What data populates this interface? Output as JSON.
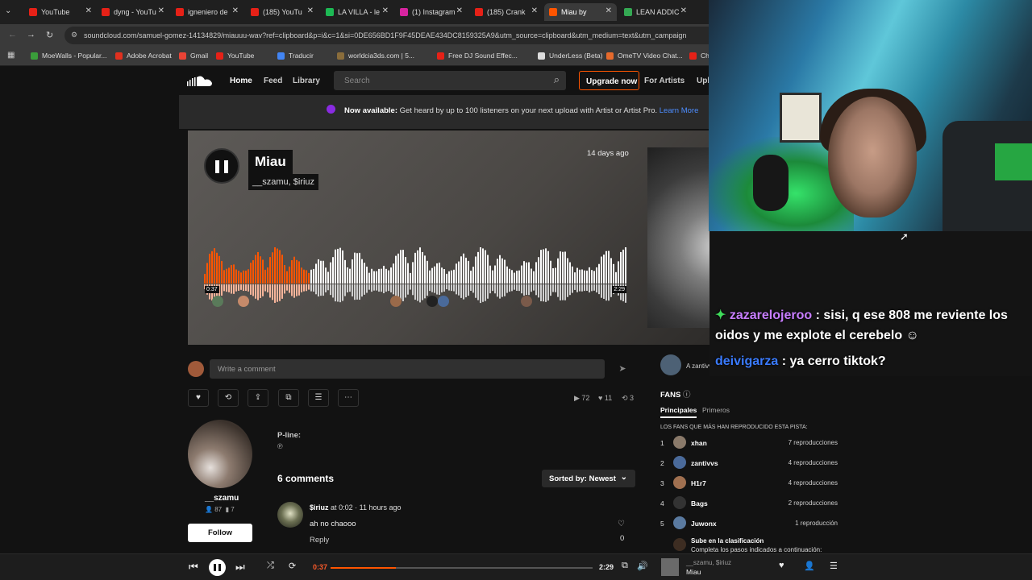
{
  "browser": {
    "tabs": [
      {
        "label": "YouTube",
        "color": "#e62117"
      },
      {
        "label": "dyng - YouTu",
        "color": "#e62117"
      },
      {
        "label": "igneniero de",
        "color": "#e62117"
      },
      {
        "label": "(185) YouTu",
        "color": "#e62117"
      },
      {
        "label": "LA VILLA - le",
        "color": "#1db954"
      },
      {
        "label": "(1) Instagram",
        "color": "#d6249f"
      },
      {
        "label": "(185) Crank",
        "color": "#e62117"
      },
      {
        "label": "Miau by",
        "color": "#ff5500"
      },
      {
        "label": "LEAN ADDIC",
        "color": "#34a853"
      }
    ],
    "url": "soundcloud.com/samuel-gomez-14134829/miauuu-wav?ref=clipboard&p=i&c=1&si=0DE656BD1F9F45DEAE434DC8159325A9&utm_source=clipboard&utm_medium=text&utm_campaign",
    "bookmarks": [
      {
        "label": "MoeWalls - Popular...",
        "color": "#3a9d3a"
      },
      {
        "label": "Adobe Acrobat",
        "color": "#e0301e"
      },
      {
        "label": "Gmail",
        "color": "#ea4335"
      },
      {
        "label": "YouTube",
        "color": "#e62117"
      },
      {
        "label": "Traducir",
        "color": "#4285f4"
      },
      {
        "label": "worldcia3ds.com | 5...",
        "color": "#8a6d3b"
      },
      {
        "label": "Free DJ Sound Effec...",
        "color": "#e62117"
      },
      {
        "label": "UnderLess (Beta)",
        "color": "#dddddd"
      },
      {
        "label": "OmeTV Video Chat...",
        "color": "#e66a2c"
      },
      {
        "label": "Cha",
        "color": "#e62117"
      }
    ]
  },
  "soundcloud": {
    "nav": {
      "home": "Home",
      "feed": "Feed",
      "library": "Library",
      "search_placeholder": "Search",
      "upgrade": "Upgrade now",
      "for_artists": "For Artists",
      "upload": "Upl"
    },
    "banner": {
      "bold": "Now available:",
      "text": " Get heard by up to 100 listeners on your next upload with Artist or Artist Pro. ",
      "link": "Learn More"
    },
    "track": {
      "title": "Miau",
      "artist": "__szamu, $iriuz",
      "posted": "14 days ago",
      "time_elapsed": "0:37",
      "time_total": "2:29",
      "progress": 0.25
    },
    "comment_placeholder": "Write a comment",
    "stats": {
      "plays": "72",
      "likes": "11",
      "reposts": "3"
    },
    "uploader": {
      "name": "__szamu",
      "followers": "87",
      "tracks": "7",
      "follow": "Follow"
    },
    "pline": {
      "label": "P-line:",
      "value": "℗"
    },
    "comments": {
      "count_label": "6 comments",
      "sort_label": "Sorted by: Newest",
      "items": [
        {
          "user": "$iriuz",
          "at": "at",
          "time": "0:02",
          "ago": "· 11 hours ago",
          "text": "ah no chaooo",
          "reply": "Reply",
          "likes": "0"
        }
      ]
    },
    "repost": {
      "text": "A zantivvs y otros usuarios les gustó esta pista"
    },
    "fans": {
      "heading": "FANS",
      "tabs": [
        "Principales",
        "Primeros"
      ],
      "subtitle": "LOS FANS QUE MÁS HAN REPRODUCIDO ESTA PISTA:",
      "list": [
        {
          "rank": "1",
          "name": "xhan",
          "plays": "7 reproducciones",
          "color": "#8a7a6a"
        },
        {
          "rank": "2",
          "name": "zantivvs",
          "plays": "4 reproducciones",
          "color": "#4a6a9a"
        },
        {
          "rank": "3",
          "name": "H1r7",
          "plays": "4 reproducciones",
          "color": "#a07050"
        },
        {
          "rank": "4",
          "name": "Bags",
          "plays": "2 reproducciones",
          "color": "#333333"
        },
        {
          "rank": "5",
          "name": "Juwonx",
          "plays": "1 reproducción",
          "color": "#5a7aa0"
        }
      ],
      "climb_title": "Sube en la clasificación",
      "climb_text": "Completa los pasos indicados a continuación:"
    }
  },
  "chat": [
    {
      "user": "zazarelojeroo",
      "user_color": "#c77dff",
      "sep": " : ",
      "text": "sisi, q ese 808 me reviente los"
    },
    {
      "user": "",
      "user_color": "#ffffff",
      "sep": "",
      "text": "oidos y me explote el cerebelo"
    },
    {
      "user": "deivigarza",
      "user_color": "#3a7bff",
      "sep": " : ",
      "text": "ya cerro tiktok?"
    }
  ],
  "player": {
    "current": "0:37",
    "duration": "2:29",
    "progress": 0.25,
    "artist": "__szamu, $iriuz",
    "title": "Miau"
  }
}
